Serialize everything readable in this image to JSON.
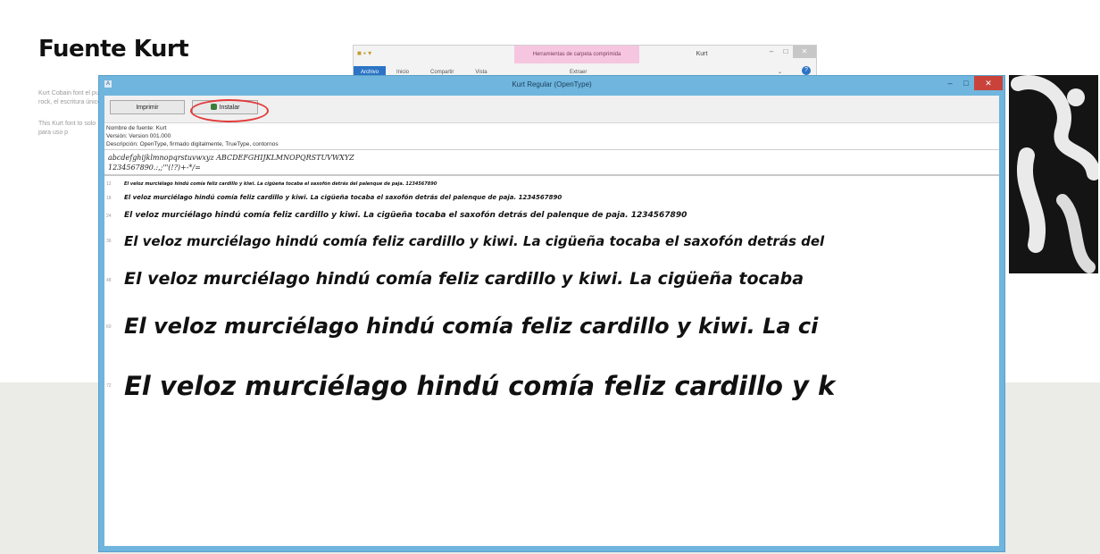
{
  "page": {
    "title": "Fuente Kurt",
    "intro_paragraphs": [
      "Kurt Cobain font el punk rock, el escritura únicos",
      "This Kurt font to solo para uso p"
    ]
  },
  "explorer": {
    "title": "Kurt",
    "context_tab": "Herramientas de carpeta comprimida",
    "ribbon_tabs": [
      "Archivo",
      "Inicio",
      "Compartir",
      "Vista"
    ],
    "manage_tab": "Extraer",
    "help": "?"
  },
  "viewer": {
    "title": "Kurt Regular (OpenType)",
    "controls": {
      "minimize": "–",
      "maximize": "□",
      "close": "✕"
    },
    "print_label": "Imprimir",
    "install_label": "Instalar",
    "info_lines": [
      "Nombre de fuente: Kurt",
      "Versión: Version 001.000",
      "Descripción: OpenType, firmado digitalmente, TrueType, contornos"
    ],
    "charset_lines": [
      "abcdefghijklmnopqrstuvwxyz ABCDEFGHIJKLMNOPQRSTUVWXYZ",
      "1234567890.:,;'\"(!?)+-*/="
    ],
    "samples": [
      {
        "size": "12",
        "text": "El veloz murciélago hindú comía feliz cardillo y kiwi. La cigüeña tocaba el saxofón detrás del palenque de paja. 1234567890"
      },
      {
        "size": "18",
        "text": "El veloz murciélago hindú comía feliz cardillo y kiwi. La cigüeña tocaba el saxofón detrás del palenque de paja. 1234567890"
      },
      {
        "size": "24",
        "text": "El veloz murciélago hindú comía feliz cardillo y kiwi. La cigüeña tocaba el saxofón detrás del palenque de paja. 1234567890"
      },
      {
        "size": "36",
        "text": "El veloz murciélago hindú comía feliz cardillo y kiwi. La cigüeña tocaba el saxofón detrás del"
      },
      {
        "size": "48",
        "text": "El veloz murciélago hindú comía feliz cardillo y kiwi. La cigüeña tocaba"
      },
      {
        "size": "60",
        "text": "El veloz murciélago hindú comía feliz cardillo y kiwi. La ci"
      },
      {
        "size": "72",
        "text": "El veloz murciélago hindú comía feliz cardillo y k"
      }
    ]
  }
}
